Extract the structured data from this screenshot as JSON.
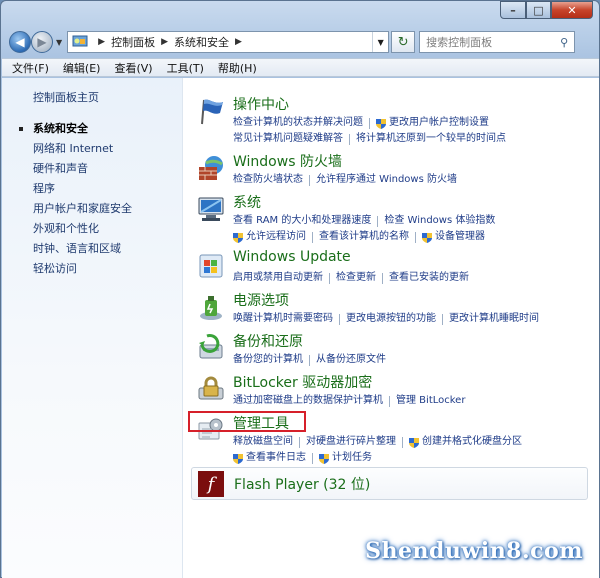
{
  "window": {
    "caption": {
      "min": "–",
      "max": "□",
      "close": "✕"
    }
  },
  "address": {
    "crumbs": [
      "控制面板",
      "系统和安全"
    ],
    "search_placeholder": "搜索控制面板"
  },
  "menu": [
    "文件(F)",
    "编辑(E)",
    "查看(V)",
    "工具(T)",
    "帮助(H)"
  ],
  "left": {
    "home": "控制面板主页",
    "items": [
      {
        "label": "系统和安全",
        "active": true
      },
      {
        "label": "网络和 Internet"
      },
      {
        "label": "硬件和声音"
      },
      {
        "label": "程序"
      },
      {
        "label": "用户帐户和家庭安全"
      },
      {
        "label": "外观和个性化"
      },
      {
        "label": "时钟、语言和区域"
      },
      {
        "label": "轻松访问"
      }
    ]
  },
  "categories": {
    "action_center": {
      "title": "操作中心",
      "links": [
        [
          "检查计算机的状态并解决问题",
          "更改用户帐户控制设置"
        ],
        [
          "常见计算机问题疑难解答",
          "将计算机还原到一个较早的时间点"
        ]
      ]
    },
    "firewall": {
      "title": "Windows 防火墙",
      "links": [
        [
          "检查防火墙状态",
          "允许程序通过 Windows 防火墙"
        ]
      ]
    },
    "system": {
      "title": "系统",
      "links": [
        [
          "查看 RAM 的大小和处理器速度",
          "检查 Windows 体验指数"
        ],
        [
          "允许远程访问",
          "查看该计算机的名称",
          "设备管理器"
        ]
      ]
    },
    "update": {
      "title": "Windows Update",
      "links": [
        [
          "启用或禁用自动更新",
          "检查更新",
          "查看已安装的更新"
        ]
      ]
    },
    "power": {
      "title": "电源选项",
      "links": [
        [
          "唤醒计算机时需要密码",
          "更改电源按钮的功能",
          "更改计算机睡眠时间"
        ]
      ]
    },
    "backup": {
      "title": "备份和还原",
      "links": [
        [
          "备份您的计算机",
          "从备份还原文件"
        ]
      ]
    },
    "bitlocker": {
      "title": "BitLocker 驱动器加密",
      "links": [
        [
          "通过加密磁盘上的数据保护计算机",
          "管理 BitLocker"
        ]
      ]
    },
    "admin": {
      "title": "管理工具",
      "links": [
        [
          "释放磁盘空间",
          "对硬盘进行碎片整理",
          "创建并格式化硬盘分区"
        ],
        [
          "查看事件日志",
          "计划任务"
        ]
      ]
    },
    "flash": {
      "title": "Flash Player (32 位)"
    }
  },
  "watermark": "Shenduwin8.com",
  "colors": {
    "category_title": "#1a6e1a",
    "link": "#1f3c88",
    "highlight": "#d6202a"
  }
}
